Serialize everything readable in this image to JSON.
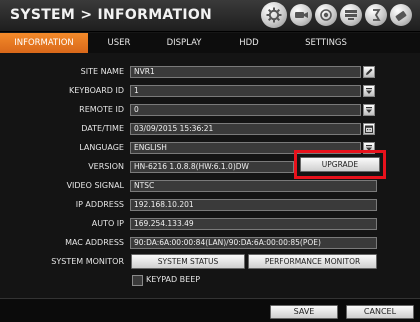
{
  "window": {
    "title": "SYSTEM > INFORMATION"
  },
  "toolbar_icons": [
    "gear-icon",
    "camera-icon",
    "record-icon",
    "network-icon",
    "event-icon",
    "storage-icon"
  ],
  "tabs": [
    {
      "label": "INFORMATION",
      "active": true
    },
    {
      "label": "USER",
      "active": false
    },
    {
      "label": "DISPLAY",
      "active": false
    },
    {
      "label": "HDD",
      "active": false
    },
    {
      "label": "SETTINGS",
      "active": false
    }
  ],
  "form": {
    "site_name": {
      "label": "SITE NAME",
      "value": "NVR1"
    },
    "keyboard_id": {
      "label": "KEYBOARD ID",
      "value": "1"
    },
    "remote_id": {
      "label": "REMOTE ID",
      "value": "0"
    },
    "datetime": {
      "label": "DATE/TIME",
      "value": "03/09/2015 15:36:21"
    },
    "language": {
      "label": "LANGUAGE",
      "value": "ENGLISH"
    },
    "version": {
      "label": "VERSION",
      "value": "HN-6216 1.0.8.8(HW:6.1.0)DW",
      "button": "UPGRADE"
    },
    "video_signal": {
      "label": "VIDEO SIGNAL",
      "value": "NTSC"
    },
    "ip_address": {
      "label": "IP ADDRESS",
      "value": "192.168.10.201"
    },
    "auto_ip": {
      "label": "AUTO IP",
      "value": "169.254.133.49"
    },
    "mac_address": {
      "label": "MAC ADDRESS",
      "value": "90:DA:6A:00:00:84(LAN)/90:DA:6A:00:00:85(POE)"
    },
    "system_monitor": {
      "label": "SYSTEM MONITOR",
      "status_button": "SYSTEM STATUS",
      "performance_button": "PERFORMANCE MONITOR"
    },
    "keypad_beep": {
      "label": "KEYPAD BEEP",
      "checked": false
    }
  },
  "footer": {
    "save": "SAVE",
    "cancel": "CANCEL"
  },
  "colors": {
    "accent": "#e8791f",
    "highlight": "#e8121c"
  }
}
